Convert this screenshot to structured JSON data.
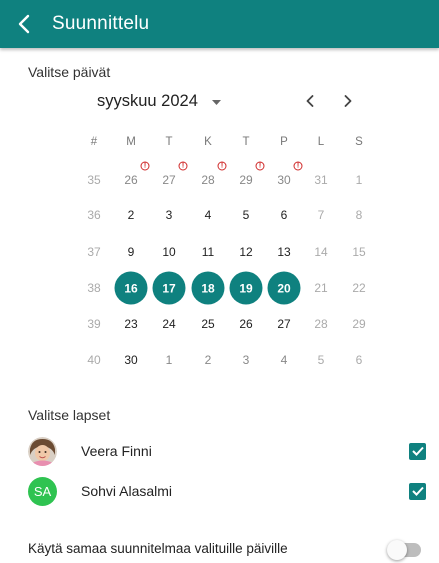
{
  "appbar": {
    "title": "Suunnittelu"
  },
  "dates_section": {
    "label": "Valitse päivät",
    "month": "syyskuu 2024"
  },
  "calendar": {
    "headers": [
      "#",
      "M",
      "T",
      "K",
      "T",
      "P",
      "L",
      "S"
    ],
    "weeks": [
      {
        "week": "35",
        "days": [
          {
            "d": "26",
            "t": "out",
            "warn": true
          },
          {
            "d": "27",
            "t": "out",
            "warn": true
          },
          {
            "d": "28",
            "t": "out",
            "warn": true
          },
          {
            "d": "29",
            "t": "out",
            "warn": true
          },
          {
            "d": "30",
            "t": "out",
            "warn": true
          },
          {
            "d": "31",
            "t": "weekend"
          },
          {
            "d": "1",
            "t": "weekend"
          }
        ]
      },
      {
        "week": "36",
        "days": [
          {
            "d": "2",
            "t": "current"
          },
          {
            "d": "3",
            "t": "current"
          },
          {
            "d": "4",
            "t": "current"
          },
          {
            "d": "5",
            "t": "current"
          },
          {
            "d": "6",
            "t": "current"
          },
          {
            "d": "7",
            "t": "weekend"
          },
          {
            "d": "8",
            "t": "weekend"
          }
        ]
      },
      {
        "week": "37",
        "days": [
          {
            "d": "9",
            "t": "current"
          },
          {
            "d": "10",
            "t": "current"
          },
          {
            "d": "11",
            "t": "current"
          },
          {
            "d": "12",
            "t": "current"
          },
          {
            "d": "13",
            "t": "current"
          },
          {
            "d": "14",
            "t": "weekend"
          },
          {
            "d": "15",
            "t": "weekend"
          }
        ]
      },
      {
        "week": "38",
        "days": [
          {
            "d": "16",
            "t": "selected"
          },
          {
            "d": "17",
            "t": "selected"
          },
          {
            "d": "18",
            "t": "selected"
          },
          {
            "d": "19",
            "t": "selected"
          },
          {
            "d": "20",
            "t": "selected"
          },
          {
            "d": "21",
            "t": "weekend"
          },
          {
            "d": "22",
            "t": "weekend"
          }
        ]
      },
      {
        "week": "39",
        "days": [
          {
            "d": "23",
            "t": "current"
          },
          {
            "d": "24",
            "t": "current"
          },
          {
            "d": "25",
            "t": "current"
          },
          {
            "d": "26",
            "t": "current"
          },
          {
            "d": "27",
            "t": "current"
          },
          {
            "d": "28",
            "t": "weekend"
          },
          {
            "d": "29",
            "t": "weekend"
          }
        ]
      },
      {
        "week": "40",
        "days": [
          {
            "d": "30",
            "t": "current"
          },
          {
            "d": "1",
            "t": "out"
          },
          {
            "d": "2",
            "t": "out"
          },
          {
            "d": "3",
            "t": "out"
          },
          {
            "d": "4",
            "t": "out"
          },
          {
            "d": "5",
            "t": "weekend"
          },
          {
            "d": "6",
            "t": "weekend"
          }
        ]
      }
    ],
    "warning_glyph": "!"
  },
  "children_section": {
    "label": "Valitse lapset",
    "children": [
      {
        "name": "Veera Finni",
        "avatar": "photo",
        "checked": true
      },
      {
        "name": "Sohvi Alasalmi",
        "avatar": "initials",
        "initials": "SA",
        "checked": true
      }
    ]
  },
  "same_plan": {
    "label": "Käytä samaa suunnitelmaa valituille päiville",
    "enabled": false
  },
  "colors": {
    "primary": "#0f817f",
    "avatar_green": "#2fc351",
    "warning": "#d02a2a"
  },
  "icons": {
    "back": "arrow-back-icon",
    "caret": "caret-down-icon",
    "prev": "chevron-left-icon",
    "next": "chevron-right-icon",
    "check": "check-icon",
    "warning": "warning-circle-icon"
  }
}
